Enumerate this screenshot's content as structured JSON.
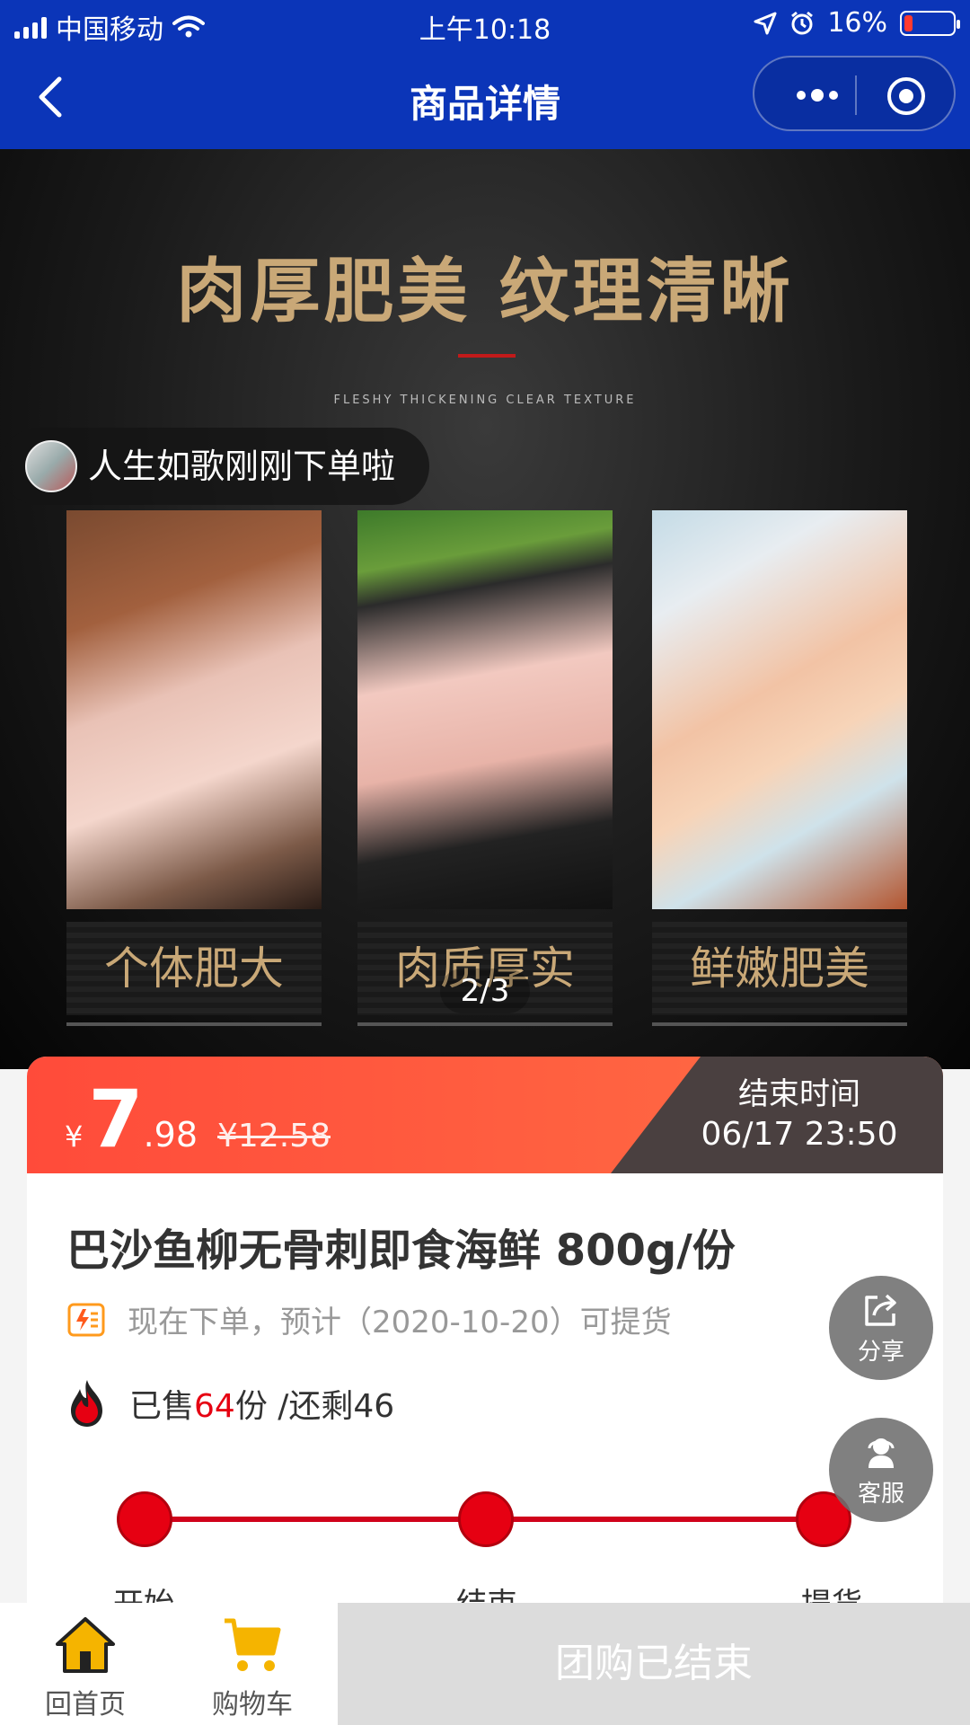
{
  "status_bar": {
    "carrier": "中国移动",
    "time": "上午10:18",
    "battery_percent": "16%",
    "battery_level": 0.16,
    "icons": [
      "signal-icon",
      "wifi-icon",
      "location-icon",
      "alarm-icon",
      "battery-icon"
    ]
  },
  "nav": {
    "title": "商品详情",
    "back_icon": "chevron-left-icon",
    "more_icon": "more-dots-icon",
    "close_icon": "target-icon"
  },
  "hero": {
    "headline": "肉厚肥美 纹理清晰",
    "subtitle": "FLESHY THICKENING CLEAR TEXTURE",
    "captions": [
      "个体肥大",
      "肉质厚实",
      "鲜嫩肥美"
    ],
    "pager": "2/3"
  },
  "ticker": {
    "text": "人生如歌刚刚下单啦"
  },
  "price": {
    "currency": "¥",
    "integer": "7",
    "decimal": ".98",
    "original": "¥12.58",
    "end_label": "结束时间",
    "end_time": "06/17 23:50"
  },
  "product": {
    "title": "巴沙鱼柳无骨刺即食海鲜 800g/份",
    "pickup_text": "现在下单，预计（2020-10-20）可提货",
    "sold_prefix": "已售",
    "sold_count": "64",
    "sold_suffix": "份 /还剩46"
  },
  "progress": {
    "steps": [
      "开始",
      "结束",
      "提货"
    ]
  },
  "floating": {
    "share_label": "分享",
    "service_label": "客服"
  },
  "bottom_bar": {
    "home_label": "回首页",
    "cart_label": "购物车",
    "status_button": "团购已结束"
  },
  "colors": {
    "nav_blue": "#0b35b8",
    "price_red": "#ff4b3a",
    "accent_red": "#e60012",
    "icon_yellow": "#f5b400"
  }
}
